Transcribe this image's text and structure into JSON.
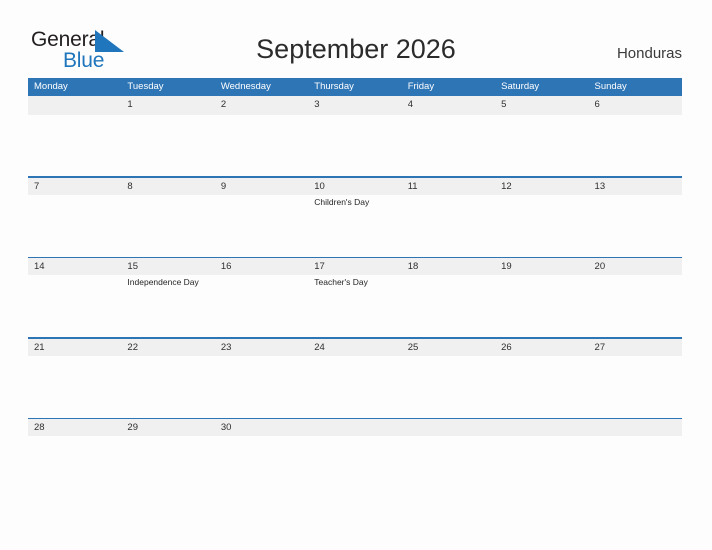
{
  "logo": {
    "word_one": "General",
    "word_two": "Blue",
    "flag_icon": "blue-flag-triangle",
    "color_dark": "#231f20",
    "color_blue": "#1f76bc"
  },
  "header": {
    "title": "September 2026",
    "country": "Honduras"
  },
  "calendar": {
    "accent_color": "#2e75b6",
    "band_color": "#f0f0f0",
    "weekdays": [
      "Monday",
      "Tuesday",
      "Wednesday",
      "Thursday",
      "Friday",
      "Saturday",
      "Sunday"
    ],
    "weeks": [
      [
        {
          "day": "",
          "events": []
        },
        {
          "day": "1",
          "events": []
        },
        {
          "day": "2",
          "events": []
        },
        {
          "day": "3",
          "events": []
        },
        {
          "day": "4",
          "events": []
        },
        {
          "day": "5",
          "events": []
        },
        {
          "day": "6",
          "events": []
        }
      ],
      [
        {
          "day": "7",
          "events": []
        },
        {
          "day": "8",
          "events": []
        },
        {
          "day": "9",
          "events": []
        },
        {
          "day": "10",
          "events": [
            "Children's Day"
          ]
        },
        {
          "day": "11",
          "events": []
        },
        {
          "day": "12",
          "events": []
        },
        {
          "day": "13",
          "events": []
        }
      ],
      [
        {
          "day": "14",
          "events": []
        },
        {
          "day": "15",
          "events": [
            "Independence Day"
          ]
        },
        {
          "day": "16",
          "events": []
        },
        {
          "day": "17",
          "events": [
            "Teacher's Day"
          ]
        },
        {
          "day": "18",
          "events": []
        },
        {
          "day": "19",
          "events": []
        },
        {
          "day": "20",
          "events": []
        }
      ],
      [
        {
          "day": "21",
          "events": []
        },
        {
          "day": "22",
          "events": []
        },
        {
          "day": "23",
          "events": []
        },
        {
          "day": "24",
          "events": []
        },
        {
          "day": "25",
          "events": []
        },
        {
          "day": "26",
          "events": []
        },
        {
          "day": "27",
          "events": []
        }
      ],
      [
        {
          "day": "28",
          "events": []
        },
        {
          "day": "29",
          "events": []
        },
        {
          "day": "30",
          "events": []
        },
        {
          "day": "",
          "events": []
        },
        {
          "day": "",
          "events": []
        },
        {
          "day": "",
          "events": []
        },
        {
          "day": "",
          "events": []
        }
      ]
    ]
  }
}
